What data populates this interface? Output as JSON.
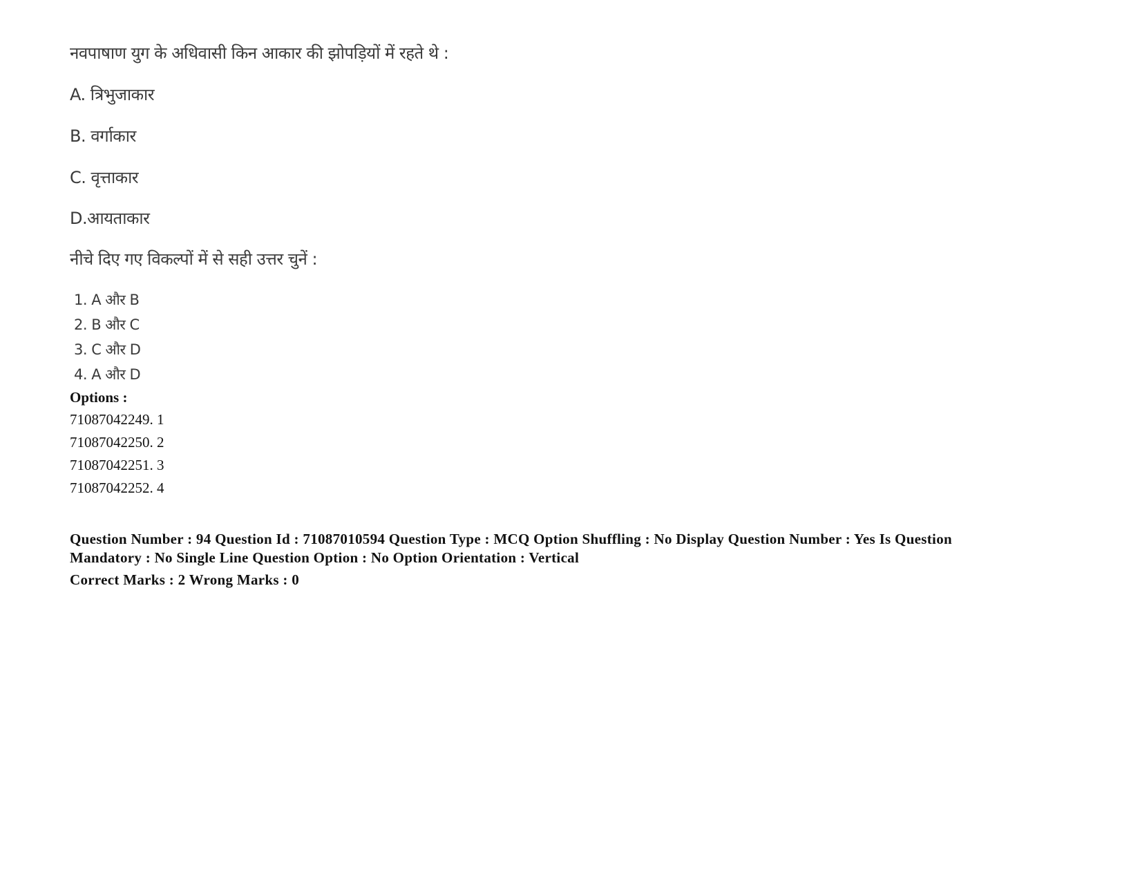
{
  "question": {
    "text": "नवपाषाण युग के अधिवासी किन आकार की झोपड़ियों में रहते थे :",
    "statements": [
      {
        "label": "A.",
        "text": "त्रिभुजाकार"
      },
      {
        "label": "B.",
        "text": "वर्गाकार"
      },
      {
        "label": "C.",
        "text": "वृत्ताकार"
      },
      {
        "label": "D.",
        "text": "आयताकार"
      }
    ],
    "statement_lines": [
      "A. त्रिभुजाकार",
      "B. वर्गाकार",
      "C. वृत्ताकार",
      "D.आयताकार"
    ],
    "instruction": "नीचे दिए गए विकल्पों में से सही उत्तर चुनें :",
    "choices": [
      "1. A और B",
      "2. B और C",
      "3. C और D",
      "4. A और D"
    ]
  },
  "options": {
    "heading": "Options :",
    "items": [
      {
        "id": "71087042249",
        "value": "1",
        "line": "71087042249. 1"
      },
      {
        "id": "71087042250",
        "value": "2",
        "line": "71087042250. 2"
      },
      {
        "id": "71087042251",
        "value": "3",
        "line": "71087042251. 3"
      },
      {
        "id": "71087042252",
        "value": "4",
        "line": "71087042252. 4"
      }
    ]
  },
  "meta": {
    "question_number": "94",
    "question_id": "71087010594",
    "question_type": "MCQ",
    "option_shuffling": "No",
    "display_question_number": "Yes",
    "is_question_mandatory": "No",
    "single_line_question_option": "No",
    "option_orientation": "Vertical",
    "correct_marks": "2",
    "wrong_marks": "0",
    "info_line": "Question Number : 94 Question Id : 71087010594 Question Type : MCQ Option Shuffling : No Display Question Number : Yes Is Question Mandatory : No Single Line Question Option : No Option Orientation : Vertical",
    "marks_line": "Correct Marks : 2 Wrong Marks : 0"
  }
}
